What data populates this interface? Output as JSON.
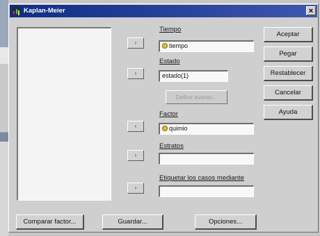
{
  "window": {
    "title": "Kaplan-Meier",
    "close_glyph": "×"
  },
  "variable_list": {
    "items": []
  },
  "transfer_glyph_right": "›",
  "transfer_glyph_left": "‹",
  "fields": {
    "tiempo": {
      "label": "Tiempo",
      "value": "tiempo"
    },
    "estado": {
      "label": "Estado",
      "value": "estado(1)",
      "define_button": "Definir evento..."
    },
    "factor": {
      "label": "Factor",
      "value": "quimio"
    },
    "estratos": {
      "label": "Estratos",
      "value": ""
    },
    "etiquetar": {
      "label": "Etiquetar los casos mediante",
      "value": ""
    }
  },
  "buttons": {
    "aceptar": "Aceptar",
    "pegar": "Pegar",
    "restablecer": "Restablecer",
    "cancelar": "Cancelar",
    "ayuda": "Ayuda",
    "comparar": "Comparar factor...",
    "guardar": "Guardar...",
    "opciones": "Opciones..."
  },
  "colors": {
    "titlebar": "#102d83",
    "dialog_bg": "#cfcfcf"
  }
}
